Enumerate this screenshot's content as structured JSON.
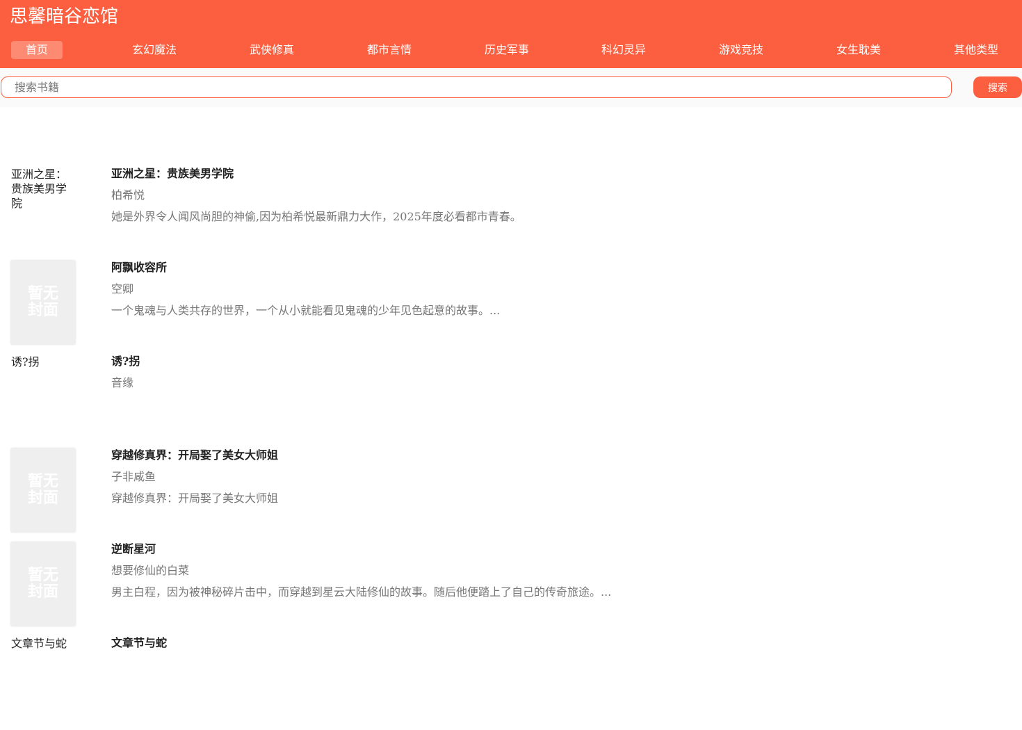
{
  "site": {
    "title": "思馨暗谷恋馆"
  },
  "nav": {
    "items": [
      {
        "label": "首页",
        "active": true
      },
      {
        "label": "玄幻魔法",
        "active": false
      },
      {
        "label": "武侠修真",
        "active": false
      },
      {
        "label": "都市言情",
        "active": false
      },
      {
        "label": "历史军事",
        "active": false
      },
      {
        "label": "科幻灵异",
        "active": false
      },
      {
        "label": "游戏竞技",
        "active": false
      },
      {
        "label": "女生耽美",
        "active": false
      },
      {
        "label": "其他类型",
        "active": false
      }
    ]
  },
  "search": {
    "placeholder": "搜索书籍",
    "button_label": "搜索"
  },
  "colors": {
    "accent": "#fb5f3f",
    "nav_active": "#fd8a73"
  },
  "books": [
    {
      "cover_type": "broken",
      "cover_alt": "亚洲之星：贵族美男学院",
      "title": "亚洲之星：贵族美男学院",
      "author": "柏希悦",
      "description": "她是外界令人闻风尚胆的神偷,因为柏希悦最新鼎力大作，2025年度必看都市青春。"
    },
    {
      "cover_type": "placeholder",
      "cover_text": "暂无封面",
      "title": "阿飘收容所",
      "author": "空卿",
      "description": "一个鬼魂与人类共存的世界，一个从小就能看见鬼魂的少年见色起意的故事。..."
    },
    {
      "cover_type": "broken",
      "cover_alt": "诱?拐",
      "title": "诱?拐",
      "author": "音缘",
      "description": ""
    },
    {
      "cover_type": "placeholder",
      "cover_text": "暂无封面",
      "title": "穿越修真界：开局娶了美女大师姐",
      "author": "子非咸鱼",
      "description": "穿越修真界：开局娶了美女大师姐"
    },
    {
      "cover_type": "placeholder",
      "cover_text": "暂无封面",
      "title": "逆断星河",
      "author": "想要修仙的白菜",
      "description": "男主白程，因为被神秘碎片击中，而穿越到星云大陆修仙的故事。随后他便踏上了自己的传奇旅途。..."
    },
    {
      "cover_type": "broken",
      "cover_alt": "文章节与蛇",
      "title": "文章节与蛇",
      "author": "",
      "description": ""
    }
  ]
}
